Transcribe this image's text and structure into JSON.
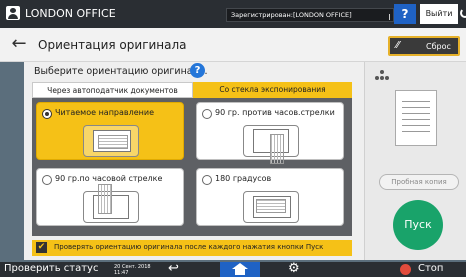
{
  "topbar": {
    "title": "LONDON OFFICE",
    "status": "Зарегистрирован:[LONDON OFFICE]",
    "help": "?",
    "logout": "Выйти"
  },
  "header": {
    "title": "Ориентация оригинала",
    "reset": "Сброс"
  },
  "main": {
    "prompt": "Выберите ориентацию оригинала.",
    "tabs": [
      "Через автоподатчик документов",
      "Со стекла экспонирования"
    ],
    "options": [
      {
        "label": "Читаемое направление",
        "selected": true
      },
      {
        "label": "90 гр. против часов.стрелки",
        "selected": false
      },
      {
        "label": "90 гр.по часовой стрелке",
        "selected": false
      },
      {
        "label": "180 градусов",
        "selected": false
      }
    ],
    "check_label": "Проверять ориентацию оригинала после каждого нажатия кнопки Пуск"
  },
  "right": {
    "sample": "Пробная копия",
    "start": "Пуск"
  },
  "bottombar": {
    "status": "Проверить статус",
    "date": "20 Сент. 2018",
    "time": "11:47",
    "stop": "Стоп"
  },
  "colors": {
    "accent": "#f5c117",
    "start": "#19a36a",
    "home": "#1f62c4",
    "stop": "#e24b3c"
  }
}
